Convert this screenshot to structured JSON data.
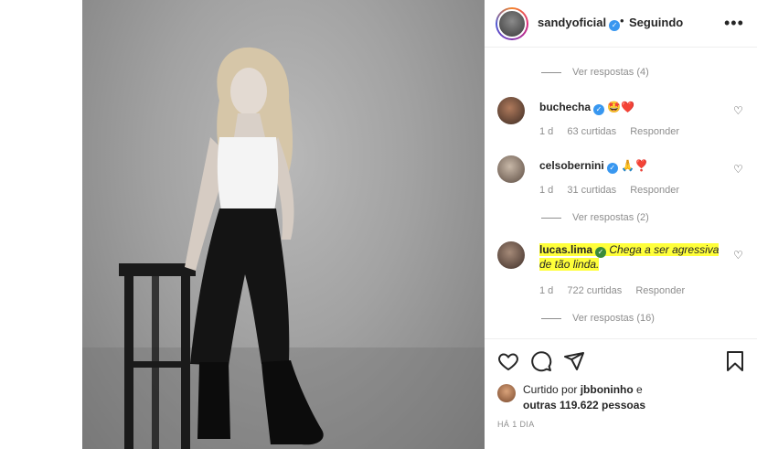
{
  "header": {
    "username": "sandyoficial",
    "separator": "•",
    "follow_status": "Seguindo",
    "more_icon": "more-horizontal-icon"
  },
  "comments": {
    "cutoff_text": "",
    "view_replies_1": "Ver respostas (4)",
    "items": [
      {
        "username": "buchecha",
        "text": "🤩❤️",
        "age": "1 d",
        "likes": "63 curtidas",
        "reply": "Responder"
      },
      {
        "username": "celsobernini",
        "text": "🙏❣️",
        "age": "1 d",
        "likes": "31 curtidas",
        "reply": "Responder"
      },
      {
        "username": "lucas.lima",
        "text_line1": "Chega a ser agressiva",
        "text_line2": "de tão linda.",
        "age": "1 d",
        "likes": "722 curtidas",
        "reply": "Responder"
      }
    ],
    "view_replies_2": "Ver respostas (2)",
    "view_replies_3": "Ver respostas (16)"
  },
  "actions": {
    "like_icon": "heart-icon",
    "comment_icon": "comment-icon",
    "share_icon": "send-icon",
    "save_icon": "bookmark-icon"
  },
  "likes": {
    "prefix": "Curtido por",
    "liker": "jbboninho",
    "connector": "e",
    "others": "outras 119.622 pessoas"
  },
  "timestamp": "HÁ 1 DIA",
  "colors": {
    "verified": "#3897f0",
    "highlight": "#ffff3a",
    "secondary_text": "#8e8e8e"
  }
}
